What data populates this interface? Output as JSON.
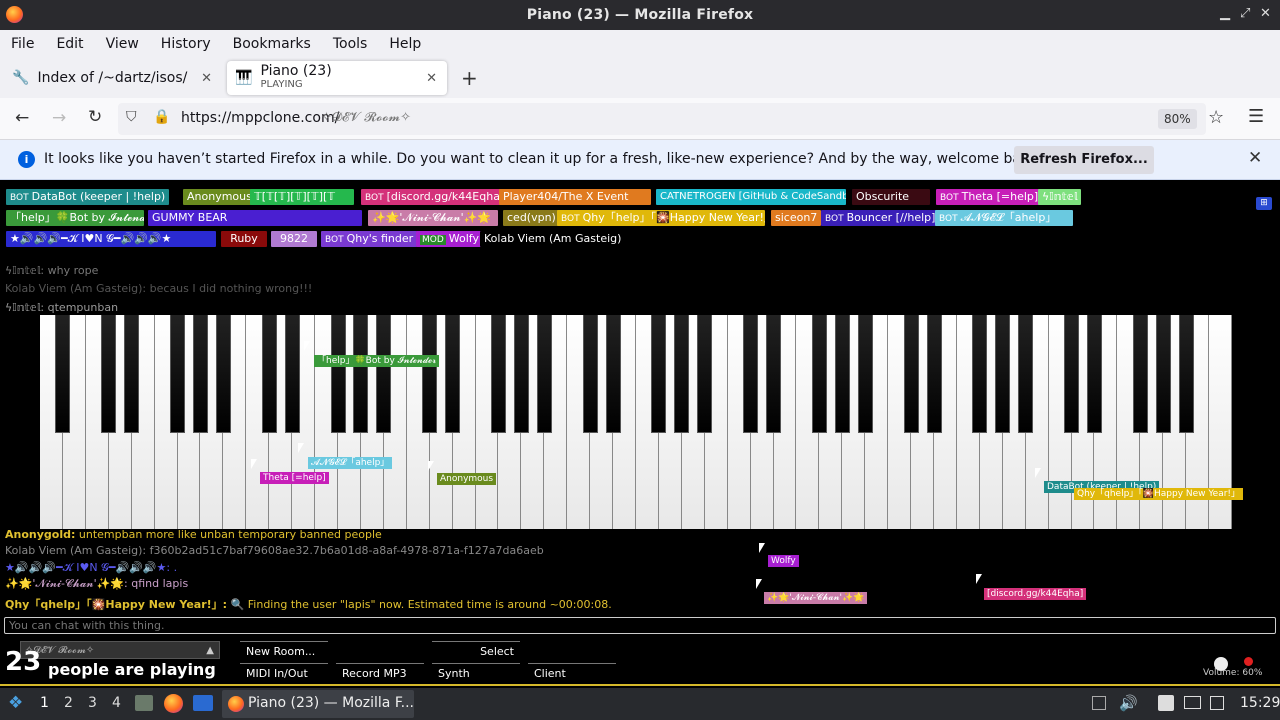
{
  "window": {
    "title": "Piano (23) — Mozilla Firefox"
  },
  "menu": [
    "File",
    "Edit",
    "View",
    "History",
    "Bookmarks",
    "Tools",
    "Help"
  ],
  "tabs": [
    {
      "label": "Index of /~dartz/isos/",
      "sub": ""
    },
    {
      "label": "Piano (23)",
      "sub": "PLAYING"
    }
  ],
  "nav": {
    "url_host": "https://mppclone.com/",
    "url_path": "✧𝓓𝓔𝓥 𝓡𝓸𝓸𝓶✧",
    "zoom": "80%"
  },
  "notification": {
    "text": "It looks like you haven’t started Firefox in a while. Do you want to clean it up for a fresh, like-new experience? And by the way, welcome back!",
    "button": "Refresh Firefox..."
  },
  "users": [
    {
      "label": "BOT",
      "name": "DataBot (keeper | !help)",
      "color": "#1e8c8c"
    },
    {
      "label": "",
      "name": "Anonymous",
      "color": "#6a8b1e"
    },
    {
      "label": "",
      "name": "𝕋[𝕋[𝕋][𝕋][𝕋][𝕋",
      "color": "#25b84d"
    },
    {
      "label": "BOT",
      "name": "[discord.gg/k44Eqha]",
      "color": "#d4317a"
    },
    {
      "label": "",
      "name": "Player404/The X Event",
      "color": "#e07a1f"
    },
    {
      "label": "",
      "name": "CATNETROGEN [GitHub & CodeSandbox]",
      "color": "#19b7c9"
    },
    {
      "label": "",
      "name": "Obscurite",
      "color": "#3a0a12"
    },
    {
      "label": "BOT",
      "name": "Theta [=help]",
      "color": "#c71fb8"
    },
    {
      "label": "",
      "name": "ϟ𝕀𝕟𝕥𝕖𝕝",
      "color": "#7ee07e"
    },
    {
      "label": "",
      "name": "「help」🍀Bot by 𝓘𝓷𝓽𝓮𝓷𝓭𝓮𝓻",
      "color": "#3a9a3a"
    },
    {
      "label": "",
      "name": "GUMMY BEAR",
      "color": "#4a1fd1"
    },
    {
      "label": "",
      "name": "✨🌟'𝓝𝓲𝓷𝓲-𝓒𝓱𝓪𝓷'✨🌟",
      "color": "#c97ca8"
    },
    {
      "label": "",
      "name": "ced(vpn)",
      "color": "#8a7a1a"
    },
    {
      "label": "BOT",
      "name": "Qhy「help」「🎇Happy New Year!」",
      "color": "#e0b80a"
    },
    {
      "label": "",
      "name": "siceon7",
      "color": "#e07a1f"
    },
    {
      "label": "BOT",
      "name": "Bouncer [//help]",
      "color": "#3a1fb8"
    },
    {
      "label": "BOT",
      "name": "𝓐𝓝𝓖𝓔𝓛「ahelp」",
      "color": "#6ac9e0"
    },
    {
      "label": "",
      "name": "★🔊🔊🔊━𝓚 I♥N 𝓖━🔊🔊🔊★",
      "color": "#2a2ad1"
    },
    {
      "label": "",
      "name": "Ruby",
      "color": "#8a0a0a"
    },
    {
      "label": "",
      "name": "9822",
      "color": "#b07ad1"
    },
    {
      "label": "BOT",
      "name": "Qhy's finder",
      "color": "#7a3ad1"
    },
    {
      "label": "MOD",
      "name": "Wolfy",
      "color": "#a71fd1"
    },
    {
      "label": "",
      "name": "Kolab Viem (Am Gasteig)",
      "color": "#000000"
    }
  ],
  "chat_top": [
    {
      "name": "ϟ𝕀𝕟𝕥𝕖𝕝:",
      "text": "why rope"
    },
    {
      "name": "Kolab Viem (Am Gasteig):",
      "text": "becaus I did nothing wrong!!!"
    },
    {
      "name": "ϟ𝕀𝕟𝕥𝕖𝕝:",
      "text": "qtempunban"
    }
  ],
  "chat_bottom": [
    {
      "name": "Anonygold:",
      "text": "untempban more like unban temporary banned people",
      "color": "#e0c030"
    },
    {
      "name": "Kolab Viem (Am Gasteig):",
      "text": "f360b2ad51c7baf79608ae32.7b6a01d8-a8af-4978-871a-f127a7da6aeb",
      "color": "#888888"
    },
    {
      "name": "★🔊🔊🔊━𝓚 I♥N 𝓖━🔊🔊🔊★:",
      "text": ".",
      "color": "#5a5af0"
    },
    {
      "name": "✨🌟'𝓝𝓲𝓷𝓲-𝓒𝓱𝓪𝓷'✨🌟:",
      "text": "qfind lapis",
      "color": "#c9a0c9"
    },
    {
      "name": "Qhy「qhelp」「🎇Happy New Year!」:",
      "text": "🔍 Finding the user \"lapis\" now. Estimated time is around ~00:00:08.",
      "color": "#e0c030"
    }
  ],
  "chat_input": {
    "placeholder": "You can chat with this thing."
  },
  "room": {
    "name": "✧𝓓𝓔𝓥 𝓡𝓸𝓸𝓶✧",
    "count": "23",
    "playing": "people are playing"
  },
  "buttons": [
    "New Room...",
    "Select",
    "MIDI In/Out",
    "Record MP3",
    "Synth",
    "Client Settings"
  ],
  "volume": "Volume: 60%",
  "cursor_tags": [
    {
      "text": "「help」🍀Bot by 𝓘𝓷𝓽𝓮𝓷𝓭𝓮𝓻",
      "color": "#3a9a3a"
    },
    {
      "text": "𝓐𝓝𝓖𝓔𝓛「ahelp」",
      "color": "#6ac9e0"
    },
    {
      "text": "Theta [=help]",
      "color": "#c71fb8"
    },
    {
      "text": "Anonymous",
      "color": "#6a8b1e"
    },
    {
      "text": "DataBot (keeper | !help)",
      "color": "#1e8c8c"
    },
    {
      "text": "Qhy「qhelp」「🎇Happy New Year!」",
      "color": "#e0b80a"
    },
    {
      "text": "Wolfy",
      "color": "#a71fd1"
    },
    {
      "text": "✨🌟'𝓝𝓲𝓷𝓲-𝓒𝓱𝓪𝓷'✨🌟",
      "color": "#c97ca8"
    },
    {
      "text": "[discord.gg/k44Eqha]",
      "color": "#d4317a"
    }
  ],
  "taskbar": {
    "workspaces": [
      "1",
      "2",
      "3",
      "4"
    ],
    "window": "Piano (23) — Mozilla F...",
    "clock": "15:29"
  }
}
